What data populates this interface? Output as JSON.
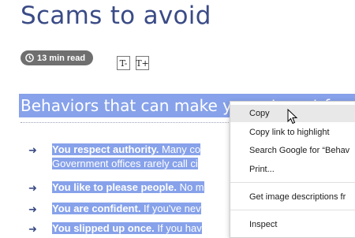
{
  "page": {
    "title": "Scams to avoid",
    "read_time": "13 min read",
    "font_decrease": "T-",
    "font_increase": "T+",
    "section_heading": "Behaviors that can make you a target for"
  },
  "items": [
    {
      "lead": "You respect authority.",
      "rest": " Many co",
      "line2": "Government offices rarely call ci"
    },
    {
      "lead": "You like to please people.",
      "rest": " No m"
    },
    {
      "lead": "You are confident.",
      "rest": " If you've nev"
    },
    {
      "lead": "You slipped up once.",
      "rest": " If you hav"
    }
  ],
  "context_menu": {
    "copy": "Copy",
    "copy_link": "Copy link to highlight",
    "search": "Search Google for “Behav",
    "print": "Print...",
    "image_descriptions": "Get image descriptions fr",
    "inspect": "Inspect"
  },
  "colors": {
    "selection": "#87a2ea",
    "title": "#3a4b86",
    "badge": "#6f6f6f"
  }
}
